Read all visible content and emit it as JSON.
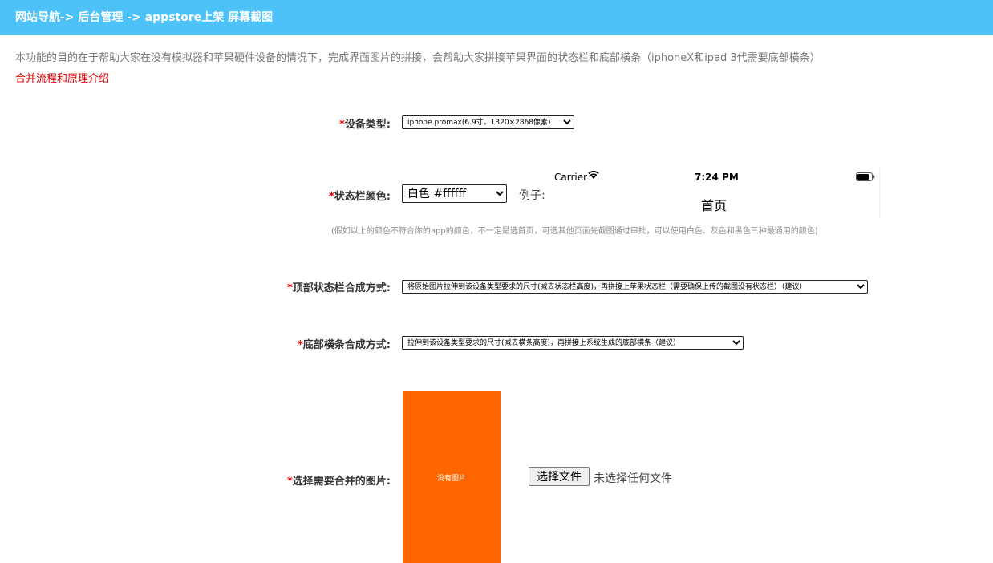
{
  "header": {
    "breadcrumb": "网站导航-> 后台管理 -> appstore上架 屏幕截图"
  },
  "intro": {
    "description": "本功能的目的在于帮助大家在没有模拟器和苹果硬件设备的情况下，完成界面图片的拼接，会帮助大家拼接苹果界面的状态栏和底部横条（iphoneX和ipad 3代需要底部横条）",
    "link": "合并流程和原理介绍"
  },
  "form": {
    "required_mark": "*",
    "device_type": {
      "label": "设备类型:",
      "selected": "iphone promax(6.9寸，1320×2868像素)"
    },
    "status_bar_color": {
      "label": "状态栏颜色:",
      "selected": "白色 #ffffff",
      "example_label": "例子:"
    },
    "preview": {
      "carrier": "Carrier",
      "time": "7:24 PM",
      "page_title": "首页",
      "icons": [
        "wifi-icon",
        "battery-icon"
      ]
    },
    "hint": "(假如以上的颜色不符合你的app的颜色，不一定是选首页，可选其他页面先截图通过审批，可以使用白色、灰色和黑色三种最通用的颜色)",
    "top_bar_method": {
      "label": "顶部状态栏合成方式:",
      "selected": "将原始图片拉伸到该设备类型要求的尺寸(减去状态栏高度)，再拼接上苹果状态栏（需要确保上传的截图没有状态栏）（建议）"
    },
    "bottom_bar_method": {
      "label": "底部横条合成方式:",
      "selected": "拉伸到该设备类型要求的尺寸(减去横条高度)，再拼接上系统生成的底部横条（建议）"
    },
    "image_select": {
      "label": "选择需要合并的图片:",
      "placeholder_text": "没有图片",
      "button": "选择文件",
      "status": "未选择任何文件"
    }
  },
  "colors": {
    "header_bg": "#4cc2f9",
    "required": "#e00000",
    "placeholder_bg": "#ff6600",
    "link": "#e00000"
  }
}
